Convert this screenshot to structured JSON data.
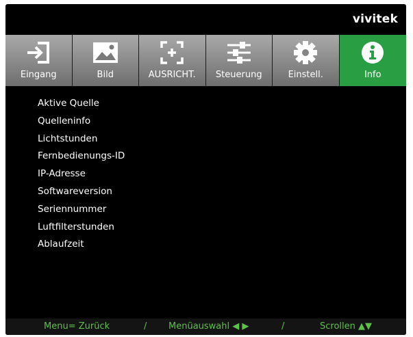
{
  "brand": "vivitek",
  "tabs": [
    {
      "label": "Eingang",
      "icon": "input-icon",
      "active": false
    },
    {
      "label": "Bild",
      "icon": "image-icon",
      "active": false
    },
    {
      "label": "AUSRICHT.",
      "icon": "alignment-icon",
      "active": false
    },
    {
      "label": "Steuerung",
      "icon": "sliders-icon",
      "active": false
    },
    {
      "label": "Einstell.",
      "icon": "gear-icon",
      "active": false
    },
    {
      "label": "Info",
      "icon": "info-icon",
      "active": true
    }
  ],
  "menu_items": [
    "Aktive Quelle",
    "Quelleninfo",
    "Lichtstunden",
    "Fernbedienungs-ID",
    "IP-Adresse",
    "Softwareversion",
    "Seriennummer",
    "Luftfilterstunden",
    "Ablaufzeit"
  ],
  "footer": {
    "back": "Menu= Zurück",
    "sep1": "/",
    "select": "Menüauswahl ◀ ▶",
    "sep2": "/",
    "scroll": "Scrollen ▲▼"
  },
  "colors": {
    "active_tab": "#2a9e43",
    "footer_text": "#5ec24a",
    "background": "#000000"
  }
}
